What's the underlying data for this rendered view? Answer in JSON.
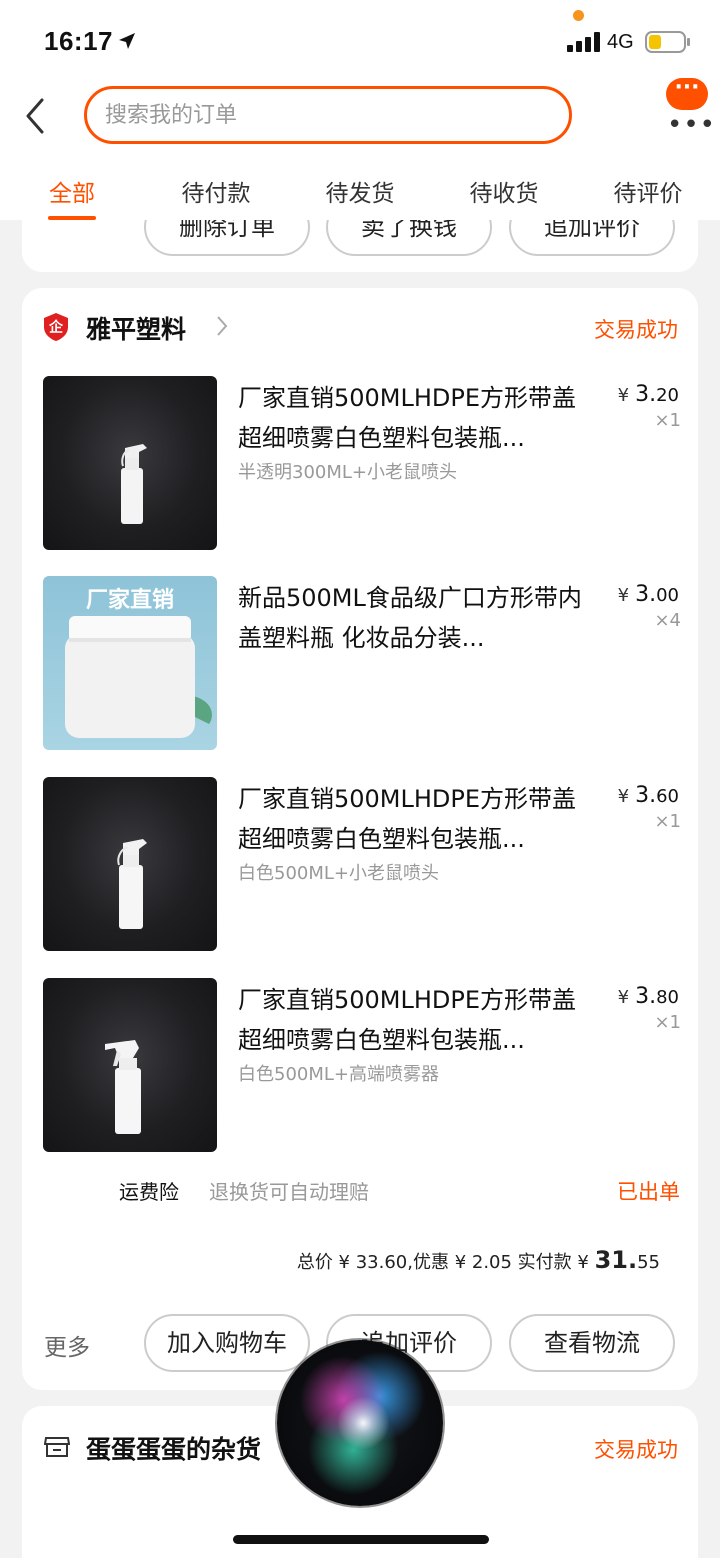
{
  "status_bar": {
    "time": "16:17",
    "network": "4G",
    "icons": [
      "location-arrow-icon",
      "signal-icon",
      "battery-icon"
    ]
  },
  "header": {
    "search_placeholder": "搜索我的订单",
    "more_badge": "···",
    "more_dots": "•••"
  },
  "tabs": [
    "全部",
    "待付款",
    "待发货",
    "待收货",
    "待评价"
  ],
  "active_tab": 0,
  "prev_order_actions": [
    "删除订单",
    "卖了换钱",
    "追加评价"
  ],
  "order": {
    "shop_name": "雅平塑料",
    "status": "交易成功",
    "items": [
      {
        "title": "厂家直销500MLHDPE方形带盖超细喷雾白色塑料包装瓶...",
        "sku": "半透明300ML+小老鼠喷头",
        "currency": "¥",
        "price_int": "3.",
        "price_dec": "20",
        "qty": "×1"
      },
      {
        "title": "新品500ML食品级广口方形带内盖塑料瓶 化妆品分装...",
        "sku": "",
        "currency": "¥",
        "price_int": "3.",
        "price_dec": "00",
        "qty": "×4",
        "image_text": "厂家直销"
      },
      {
        "title": "厂家直销500MLHDPE方形带盖超细喷雾白色塑料包装瓶...",
        "sku": "白色500ML+小老鼠喷头",
        "currency": "¥",
        "price_int": "3.",
        "price_dec": "60",
        "qty": "×1"
      },
      {
        "title": "厂家直销500MLHDPE方形带盖超细喷雾白色塑料包装瓶...",
        "sku": "白色500ML+高端喷雾器",
        "currency": "¥",
        "price_int": "3.",
        "price_dec": "80",
        "qty": "×1"
      }
    ],
    "insurance_label": "运费险",
    "insurance_desc": "退换货可自动理赔",
    "insurance_status": "已出单",
    "totals": {
      "prefix": "总价 ¥ 33.60,优惠 ¥ 2.05 实付款 ¥ ",
      "paid_int": "31.",
      "paid_dec": "55"
    },
    "more_label": "更多",
    "actions": [
      "加入购物车",
      "追加评价",
      "查看物流"
    ]
  },
  "next_order": {
    "shop_name": "蛋蛋蛋蛋的杂货",
    "status": "交易成功"
  },
  "colors": {
    "accent": "#ff5000",
    "background": "#f2f2f2",
    "card": "#ffffff",
    "muted_text": "#999999"
  }
}
